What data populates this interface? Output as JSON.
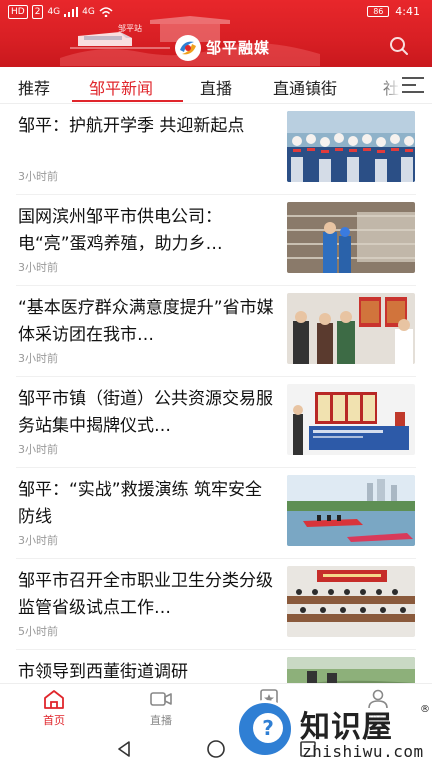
{
  "status_bar": {
    "left_chips": [
      "HD",
      "2",
      "4G",
      "4G"
    ],
    "time": "4:41",
    "battery": "86"
  },
  "header": {
    "brand": "邹平融媒",
    "banner_caption": "邹平站"
  },
  "tabs": [
    {
      "label": "推荐"
    },
    {
      "label": "邹平新闻"
    },
    {
      "label": "直播"
    },
    {
      "label": "直通镇街"
    },
    {
      "label": "社"
    }
  ],
  "news": [
    {
      "title": "邹平：护航开学季 共迎新起点",
      "time": "3小时前",
      "thumb": "students-flag"
    },
    {
      "title": "国网滨州邹平市供电公司：电“亮”蛋鸡养殖，助力乡…",
      "time": "3小时前",
      "thumb": "poultry-workers"
    },
    {
      "title": "“基本医疗群众满意度提升”省市媒体采访团在我市…",
      "time": "3小时前",
      "thumb": "medical-visit"
    },
    {
      "title": "邹平市镇（街道）公共资源交易服务站集中揭牌仪式…",
      "time": "3小时前",
      "thumb": "plaque-ceremony"
    },
    {
      "title": "邹平：“实战”救援演练 筑牢安全防线",
      "time": "3小时前",
      "thumb": "rescue-boat"
    },
    {
      "title": "邹平市召开全市职业卫生分类分级监管省级试点工作…",
      "time": "5小时前",
      "thumb": "conference-room"
    },
    {
      "title": "市领导到西董街道调研",
      "time": "",
      "thumb": "street-survey"
    }
  ],
  "bottom_nav": [
    {
      "label": "首页",
      "icon": "home-icon",
      "active": true
    },
    {
      "label": "直播",
      "icon": "video-camera-icon",
      "active": false
    },
    {
      "label": "",
      "icon": "star-bookmark-icon",
      "active": false
    },
    {
      "label": "我的",
      "icon": "user-icon",
      "active": false
    }
  ],
  "watermark": {
    "name": "知识屋",
    "reg": "®",
    "url": "zhishiwu.com"
  },
  "colors": {
    "brand_red": "#e0262c",
    "header_red": "#d81f24"
  }
}
